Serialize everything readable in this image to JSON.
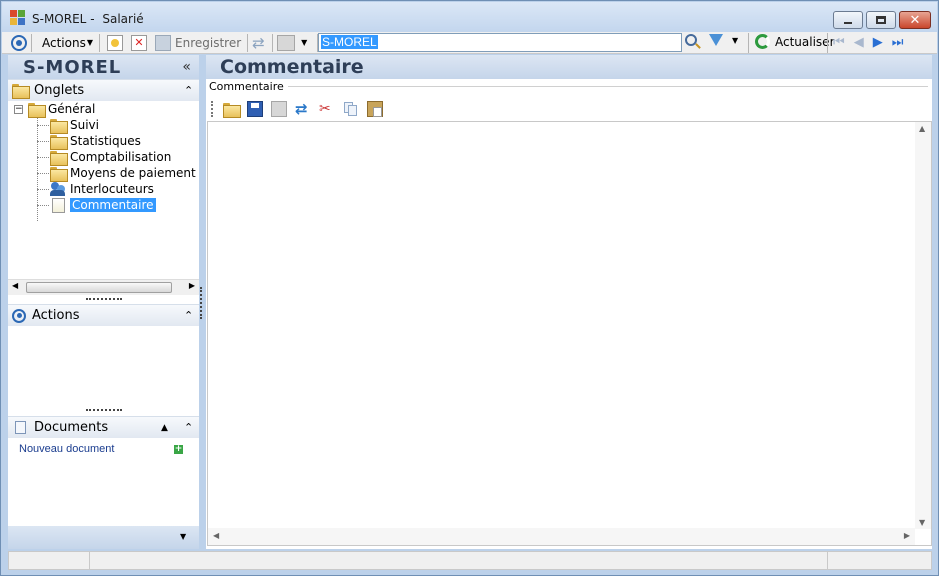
{
  "window": {
    "title_company": "S-MOREL",
    "title_sep": "-",
    "title_module": "Salarié",
    "minimize_icon": "minimize-icon",
    "maximize_icon": "maximize-icon",
    "close_icon": "close-icon"
  },
  "toolbar": {
    "actions_label": "Actions",
    "save_label": "Enregistrer",
    "search_value": "S-MOREL",
    "refresh_label": "Actualiser"
  },
  "sidebar": {
    "record_name": "S-MOREL",
    "tabs_section": "Onglets",
    "tree": {
      "root": "Général",
      "children": [
        "Suivi",
        "Statistiques",
        "Comptabilisation",
        "Moyens de paiement",
        "Interlocuteurs",
        "Commentaire"
      ],
      "selected": "Commentaire"
    },
    "actions_section": "Actions",
    "documents_section": "Documents",
    "new_document_label": "Nouveau document"
  },
  "main": {
    "title": "Commentaire",
    "group_label": "Commentaire"
  },
  "colors": {
    "accent": "#3399ff",
    "header_text": "#2e3e57",
    "link": "#1b3d8f"
  }
}
